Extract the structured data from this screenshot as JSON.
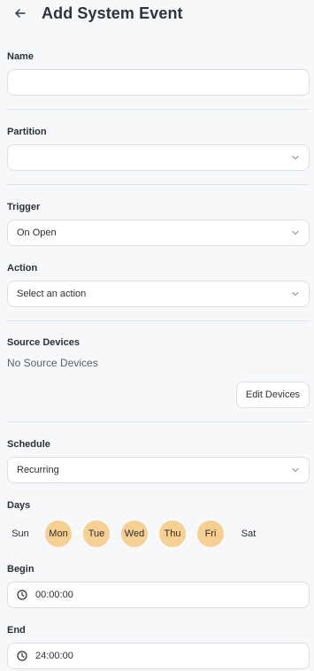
{
  "header": {
    "title": "Add System Event"
  },
  "name": {
    "label": "Name",
    "value": "",
    "placeholder": ""
  },
  "partition": {
    "label": "Partition",
    "value": ""
  },
  "trigger": {
    "label": "Trigger",
    "value": "On Open"
  },
  "action": {
    "label": "Action",
    "value": "Select an action"
  },
  "source_devices": {
    "label": "Source Devices",
    "empty_text": "No Source Devices",
    "edit_button": "Edit Devices"
  },
  "schedule": {
    "label": "Schedule",
    "value": "Recurring"
  },
  "days": {
    "label": "Days",
    "items": [
      {
        "label": "Sun",
        "selected": false
      },
      {
        "label": "Mon",
        "selected": true
      },
      {
        "label": "Tue",
        "selected": true
      },
      {
        "label": "Wed",
        "selected": true
      },
      {
        "label": "Thu",
        "selected": true
      },
      {
        "label": "Fri",
        "selected": true
      },
      {
        "label": "Sat",
        "selected": false
      }
    ]
  },
  "begin": {
    "label": "Begin",
    "value": "00:00:00"
  },
  "end": {
    "label": "End",
    "value": "24:00:00"
  },
  "colors": {
    "accent_day": "#f6cf93",
    "border": "#dcdfe4",
    "background": "#f7f8fa"
  },
  "icons": {
    "back": "arrow-left-icon",
    "dropdown": "chevron-down-icon",
    "time": "clock-icon"
  }
}
